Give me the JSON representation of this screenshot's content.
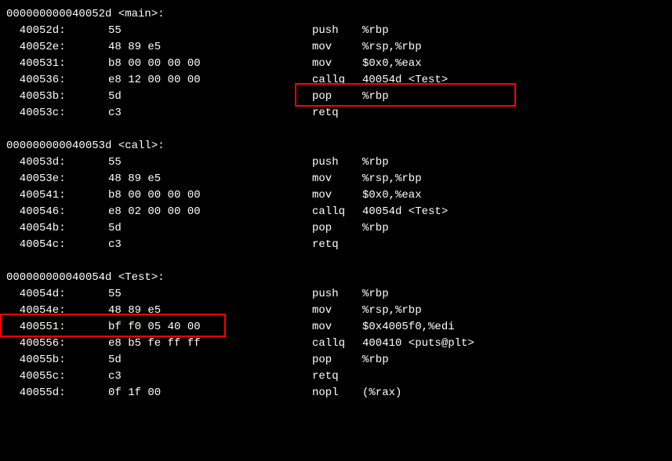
{
  "sections": [
    {
      "header": "000000000040052d <main>:",
      "lines": [
        {
          "addr": "  40052d:",
          "bytes": "55",
          "mnem": "push",
          "oper": "%rbp"
        },
        {
          "addr": "  40052e:",
          "bytes": "48 89 e5",
          "mnem": "mov",
          "oper": "%rsp,%rbp"
        },
        {
          "addr": "  400531:",
          "bytes": "b8 00 00 00 00",
          "mnem": "mov",
          "oper": "$0x0,%eax"
        },
        {
          "addr": "  400536:",
          "bytes": "e8 12 00 00 00",
          "mnem": "callq",
          "oper": "40054d <Test>"
        },
        {
          "addr": "  40053b:",
          "bytes": "5d",
          "mnem": "pop",
          "oper": "%rbp"
        },
        {
          "addr": "  40053c:",
          "bytes": "c3",
          "mnem": "retq",
          "oper": ""
        }
      ]
    },
    {
      "header": "000000000040053d <call>:",
      "lines": [
        {
          "addr": "  40053d:",
          "bytes": "55",
          "mnem": "push",
          "oper": "%rbp"
        },
        {
          "addr": "  40053e:",
          "bytes": "48 89 e5",
          "mnem": "mov",
          "oper": "%rsp,%rbp"
        },
        {
          "addr": "  400541:",
          "bytes": "b8 00 00 00 00",
          "mnem": "mov",
          "oper": "$0x0,%eax"
        },
        {
          "addr": "  400546:",
          "bytes": "e8 02 00 00 00",
          "mnem": "callq",
          "oper": "40054d <Test>"
        },
        {
          "addr": "  40054b:",
          "bytes": "5d",
          "mnem": "pop",
          "oper": "%rbp"
        },
        {
          "addr": "  40054c:",
          "bytes": "c3",
          "mnem": "retq",
          "oper": ""
        }
      ]
    },
    {
      "header": "000000000040054d <Test>:",
      "lines": [
        {
          "addr": "  40054d:",
          "bytes": "55",
          "mnem": "push",
          "oper": "%rbp"
        },
        {
          "addr": "  40054e:",
          "bytes": "48 89 e5",
          "mnem": "mov",
          "oper": "%rsp,%rbp"
        },
        {
          "addr": "  400551:",
          "bytes": "bf f0 05 40 00",
          "mnem": "mov",
          "oper": "$0x4005f0,%edi"
        },
        {
          "addr": "  400556:",
          "bytes": "e8 b5 fe ff ff",
          "mnem": "callq",
          "oper": "400410 <puts@plt>"
        },
        {
          "addr": "  40055b:",
          "bytes": "5d",
          "mnem": "pop",
          "oper": "%rbp"
        },
        {
          "addr": "  40055c:",
          "bytes": "c3",
          "mnem": "retq",
          "oper": ""
        },
        {
          "addr": "  40055d:",
          "bytes": "0f 1f 00",
          "mnem": "nopl",
          "oper": "(%rax)"
        }
      ]
    }
  ]
}
